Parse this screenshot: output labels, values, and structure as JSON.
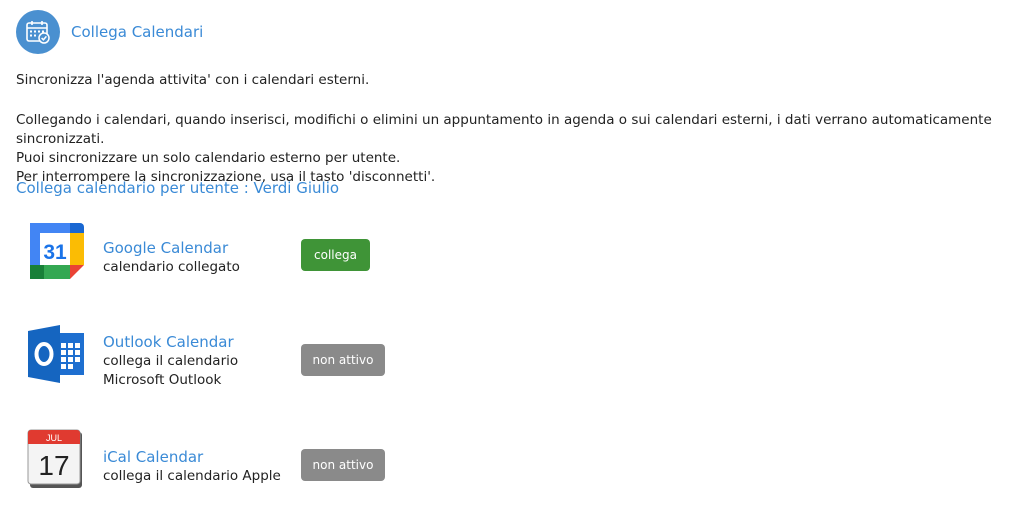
{
  "header": {
    "title": "Collega Calendari",
    "icon": "calendar-check-icon",
    "accent": "#4a90d0"
  },
  "intro": {
    "line1": "Sincronizza l'agenda attivita' con i calendari esterni.",
    "line2": "Collegando i calendari, quando inserisci, modifichi o elimini un appuntamento in agenda o sui calendari esterni, i dati verrano automaticamente sincronizzati.",
    "line3": "Puoi sincronizzare un solo calendario esterno per utente.",
    "line4": "Per interrompere la sincronizzazione, usa il tasto 'disconnetti'."
  },
  "user_line": "Collega calendario per utente : Verdi Giulio",
  "calendars": [
    {
      "name": "Google Calendar",
      "desc": "calendario collegato",
      "button": "collega",
      "button_color": "#3f9437",
      "icon": "google-calendar-icon"
    },
    {
      "name": "Outlook Calendar",
      "desc": "collega il calendario Microsoft Outlook",
      "button": "non attivo",
      "button_color": "#8a8a8a",
      "icon": "outlook-calendar-icon"
    },
    {
      "name": "iCal Calendar",
      "desc": "collega il calendario Apple",
      "button": "non attivo",
      "button_color": "#8a8a8a",
      "icon": "ical-calendar-icon"
    }
  ],
  "google_logo_day": "31",
  "ical_logo": {
    "month": "JUL",
    "day": "17"
  }
}
